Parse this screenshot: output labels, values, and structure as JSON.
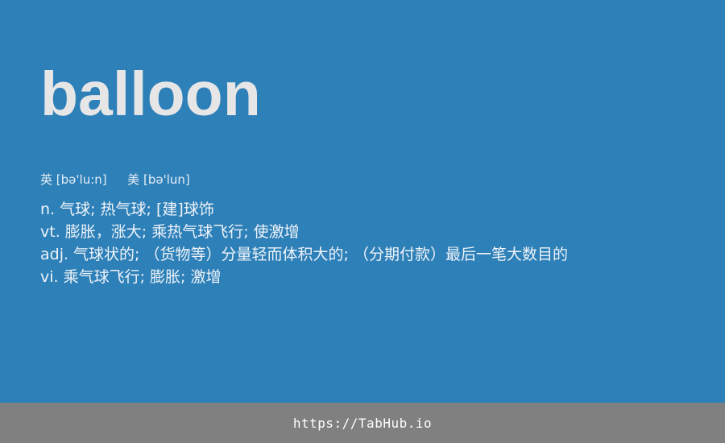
{
  "word": "balloon",
  "pronunciation": {
    "uk_label": "英",
    "uk_ipa": "[bə'lu:n]",
    "us_label": "美",
    "us_ipa": "[bə'lun]"
  },
  "definitions": [
    "n. 气球; 热气球; [建]球饰",
    "vt. 膨胀，涨大; 乘热气球飞行; 使激增",
    "adj. 气球状的; （货物等）分量轻而体积大的; （分期付款）最后一笔大数目的",
    "vi. 乘气球飞行; 膨胀; 激增"
  ],
  "footer": {
    "link_text": "https://TabHub.io"
  },
  "colors": {
    "background": "#2e80b9",
    "footer_background": "#808080",
    "word_text": "#e6e6e6"
  }
}
